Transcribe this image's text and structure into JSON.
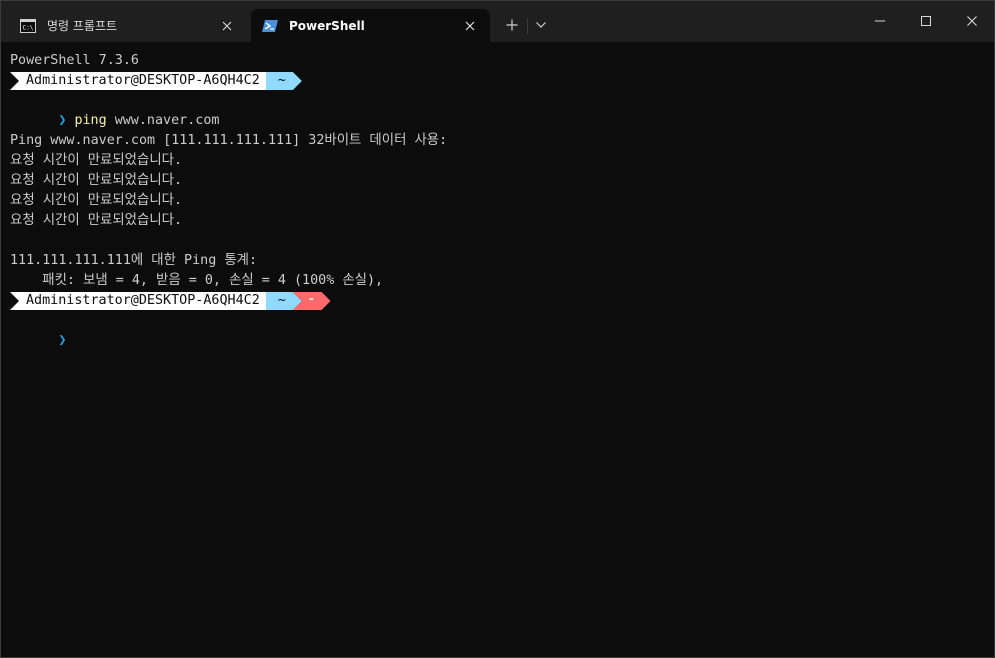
{
  "tabs": [
    {
      "title": "명령 프롬프트",
      "icon": "cmd-icon",
      "active": false
    },
    {
      "title": "PowerShell",
      "icon": "powershell-icon",
      "active": true
    }
  ],
  "titlebar": {
    "new_tab_icon": "plus-icon",
    "dropdown_icon": "chevron-down-icon",
    "minimize_icon": "minimize-icon",
    "maximize_icon": "maximize-icon",
    "close_icon": "close-icon"
  },
  "terminal": {
    "version_line": "PowerShell 7.3.6",
    "prompt1": {
      "user": "Administrator@DESKTOP-A6QH4C2",
      "path": "~"
    },
    "command": {
      "caret": "❯",
      "name": "ping",
      "args": "www.naver.com"
    },
    "output": [
      "",
      "Ping www.naver.com [111.111.111.111] 32바이트 데이터 사용:",
      "요청 시간이 만료되었습니다.",
      "요청 시간이 만료되었습니다.",
      "요청 시간이 만료되었습니다.",
      "요청 시간이 만료되었습니다.",
      "",
      "111.111.111.111에 대한 Ping 통계:",
      "    패킷: 보냄 = 4, 받음 = 0, 손실 = 4 (100% 손실),"
    ],
    "prompt2": {
      "user": "Administrator@DESKTOP-A6QH4C2",
      "path": "~",
      "status": "⁃"
    },
    "cursor_caret": "❯"
  },
  "colors": {
    "background": "#0c0c0c",
    "titlebar": "#1f1f1f",
    "text": "#cccccc",
    "command": "#f9f1a5",
    "caret": "#2aa1e6",
    "segment_user": "#ffffff",
    "segment_path": "#90d9ff",
    "segment_error": "#ff6b6b"
  }
}
